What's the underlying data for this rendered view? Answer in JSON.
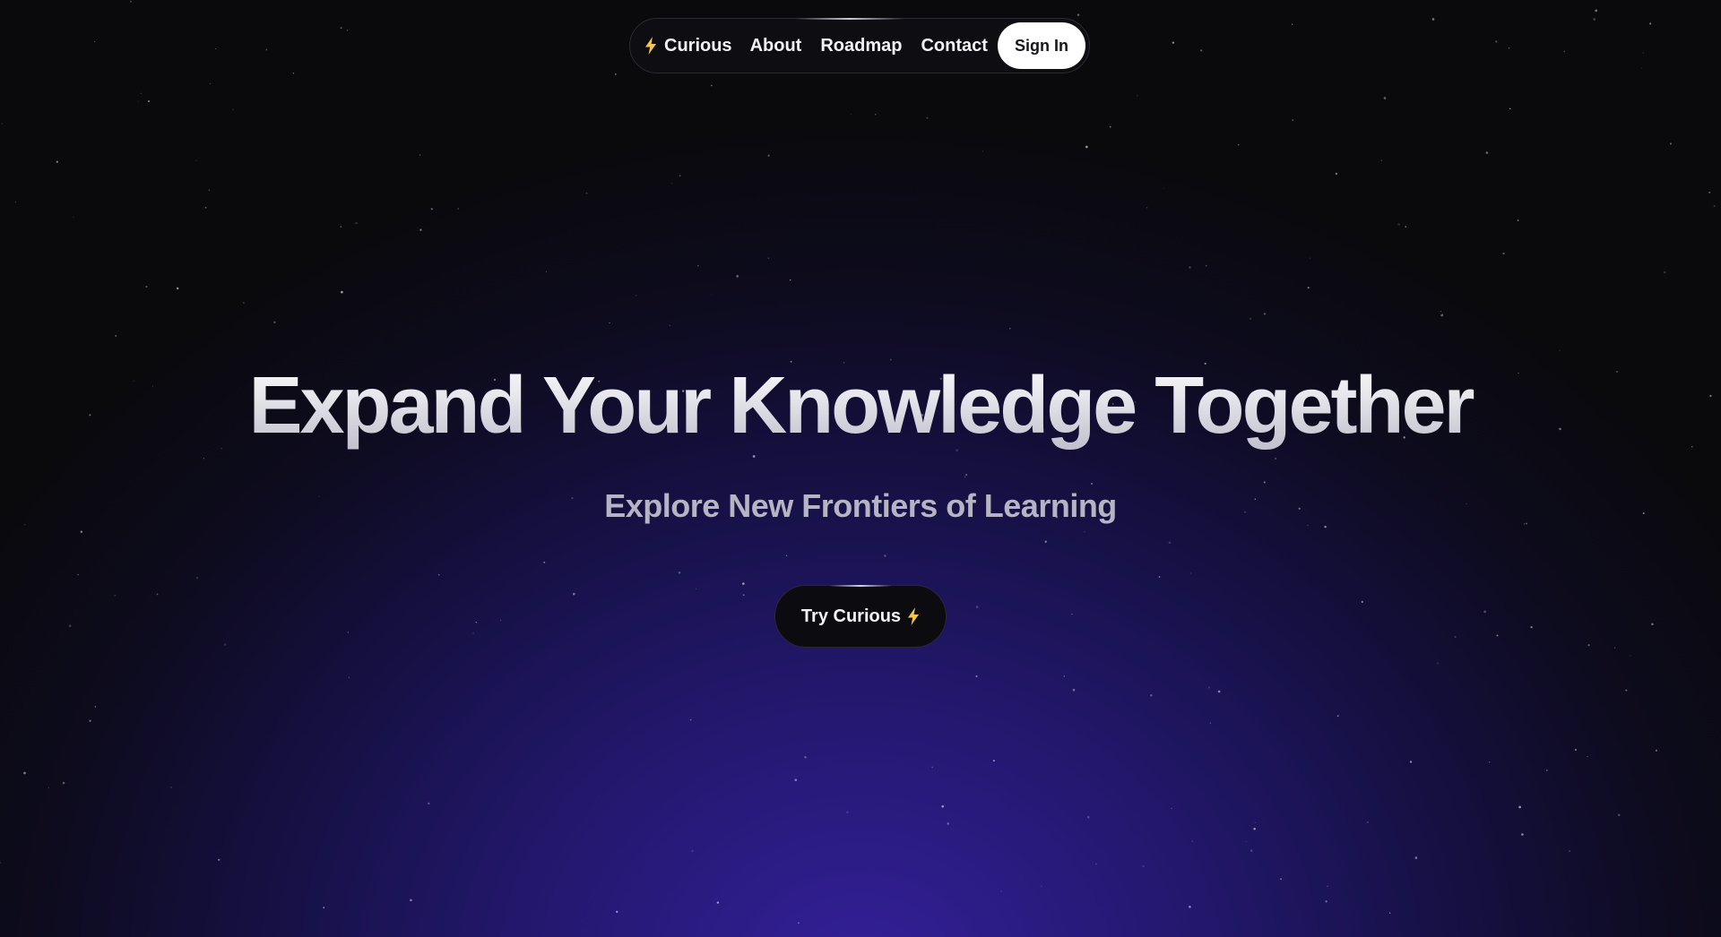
{
  "nav": {
    "brand_label": "Curious",
    "brand_icon": "lightning-bolt",
    "links": [
      {
        "label": "About"
      },
      {
        "label": "Roadmap"
      },
      {
        "label": "Contact"
      }
    ],
    "signin_label": "Sign In"
  },
  "hero": {
    "title": "Expand Your Knowledge Together",
    "subtitle": "Explore New Frontiers of Learning",
    "cta_label": "Try Curious",
    "cta_icon": "lightning-bolt"
  },
  "colors": {
    "background": "#0a0a0c",
    "glow_purple": "#34219a",
    "bolt_yellow": "#f5c842",
    "button_white": "#ffffff"
  }
}
